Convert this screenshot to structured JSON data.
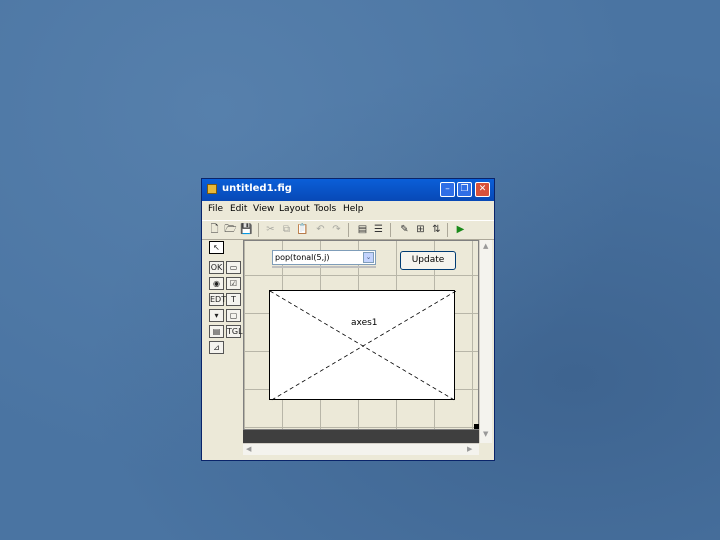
{
  "window": {
    "title": "untitled1.fig",
    "controls": {
      "minimize": "–",
      "restore": "❐",
      "close": "✕"
    }
  },
  "menubar": {
    "items": [
      {
        "label": "File"
      },
      {
        "label": "Edit"
      },
      {
        "label": "View"
      },
      {
        "label": "Layout"
      },
      {
        "label": "Tools"
      },
      {
        "label": "Help"
      }
    ]
  },
  "toolbar": {
    "icons": [
      "new-icon",
      "open-icon",
      "save-icon",
      "cut-icon",
      "copy-icon",
      "paste-icon",
      "undo-icon",
      "redo-icon",
      "align-icon",
      "menu-editor-icon",
      "property-inspector-icon",
      "object-browser-icon",
      "tab-order-icon",
      "run-icon"
    ],
    "glyphs": {
      "new": "🗋",
      "open": "🗁",
      "save": "💾",
      "cut": "✂",
      "copy": "⧉",
      "paste": "📋",
      "undo": "↶",
      "redo": "↷",
      "align": "▤",
      "menu_editor": "☰",
      "inspector": "✎",
      "browser": "⊞",
      "taborder": "⇅",
      "run": "▶"
    },
    "run_color": "#1a8a1a"
  },
  "palette": {
    "glyphs": {
      "select": "↖",
      "push": "OK",
      "slider": "▭",
      "radio": "◉",
      "check": "☑",
      "edit": "EDT",
      "text": "T",
      "popup": "▾",
      "listbox": "▤",
      "toggle": "TGL",
      "axes": "⊿",
      "panel": "▢",
      "group": "▣",
      "activex": "X"
    }
  },
  "canvas": {
    "popupmenu": {
      "text": "pop(tonal(5,j)",
      "arrow": "⌄"
    },
    "pushbutton": {
      "label": "Update"
    },
    "axes": {
      "label": "axes1"
    }
  },
  "colors": {
    "title_bar": "#0a5fd8",
    "window_bg": "#ece9d8",
    "desktop": "#4a74a2"
  }
}
